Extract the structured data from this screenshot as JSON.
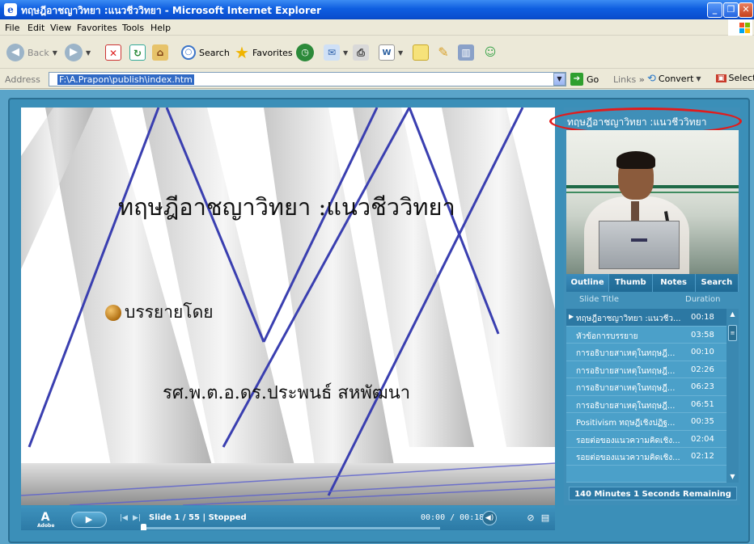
{
  "window": {
    "title": "ทฤษฎีอาชญาวิทยา :แนวชีววิทยา - Microsoft Internet Explorer"
  },
  "menu": [
    "File",
    "Edit",
    "View",
    "Favorites",
    "Tools",
    "Help"
  ],
  "toolbar": {
    "back_label": "Back",
    "search_label": "Search",
    "favorites_label": "Favorites"
  },
  "address": {
    "label": "Address",
    "value": "F:\\A.Prapon\\publish\\index.htm",
    "go_label": "Go",
    "links_label": "Links",
    "convert_label": "Convert",
    "select_label": "Select"
  },
  "slide": {
    "title": "ทฤษฎีอาชญาวิทยา :แนวชีววิทยา",
    "bullet": "บรรยายโดย",
    "presenter": "รศ.พ.ต.อ.ดร.ประพนธ์ สหพัฒนา"
  },
  "player": {
    "status": "Slide 1 / 55 | Stopped",
    "time": "00:00 / 00:18",
    "progress_fraction": 0.0,
    "adobe_label": "Adobe"
  },
  "sidebar": {
    "title": "ทฤษฎีอาชญาวิทยา :แนวชีววิทยา",
    "tabs": [
      "Outline",
      "Thumb",
      "Notes",
      "Search"
    ],
    "col_title": "Slide Title",
    "col_duration": "Duration",
    "slides": [
      {
        "title": "ทฤษฎีอาชญาวิทยา :แนวชีว...",
        "duration": "00:18"
      },
      {
        "title": "หัวข้อการบรรยาย",
        "duration": "03:58"
      },
      {
        "title": "การอธิบายสาเหตุในทฤษฎี...",
        "duration": "00:10"
      },
      {
        "title": "การอธิบายสาเหตุในทฤษฎี...",
        "duration": "02:26"
      },
      {
        "title": "การอธิบายสาเหตุในทฤษฎี...",
        "duration": "06:23"
      },
      {
        "title": "การอธิบายสาเหตุในทฤษฎี...",
        "duration": "06:51"
      },
      {
        "title": "Positivism ทฤษฎีเชิงปฏิฐ...",
        "duration": "00:35"
      },
      {
        "title": "รอยต่อของแนวความคิดเชิง...",
        "duration": "02:04"
      },
      {
        "title": "รอยต่อของแนวความคิดเชิง...",
        "duration": "02:12"
      },
      {
        "title": "",
        "duration": ""
      }
    ],
    "remaining": "140 Minutes 1 Seconds Remaining"
  },
  "colors": {
    "titlebar": "#0f5ee0",
    "player_bg": "#3f8fb8",
    "highlight": "#e21b1b"
  }
}
